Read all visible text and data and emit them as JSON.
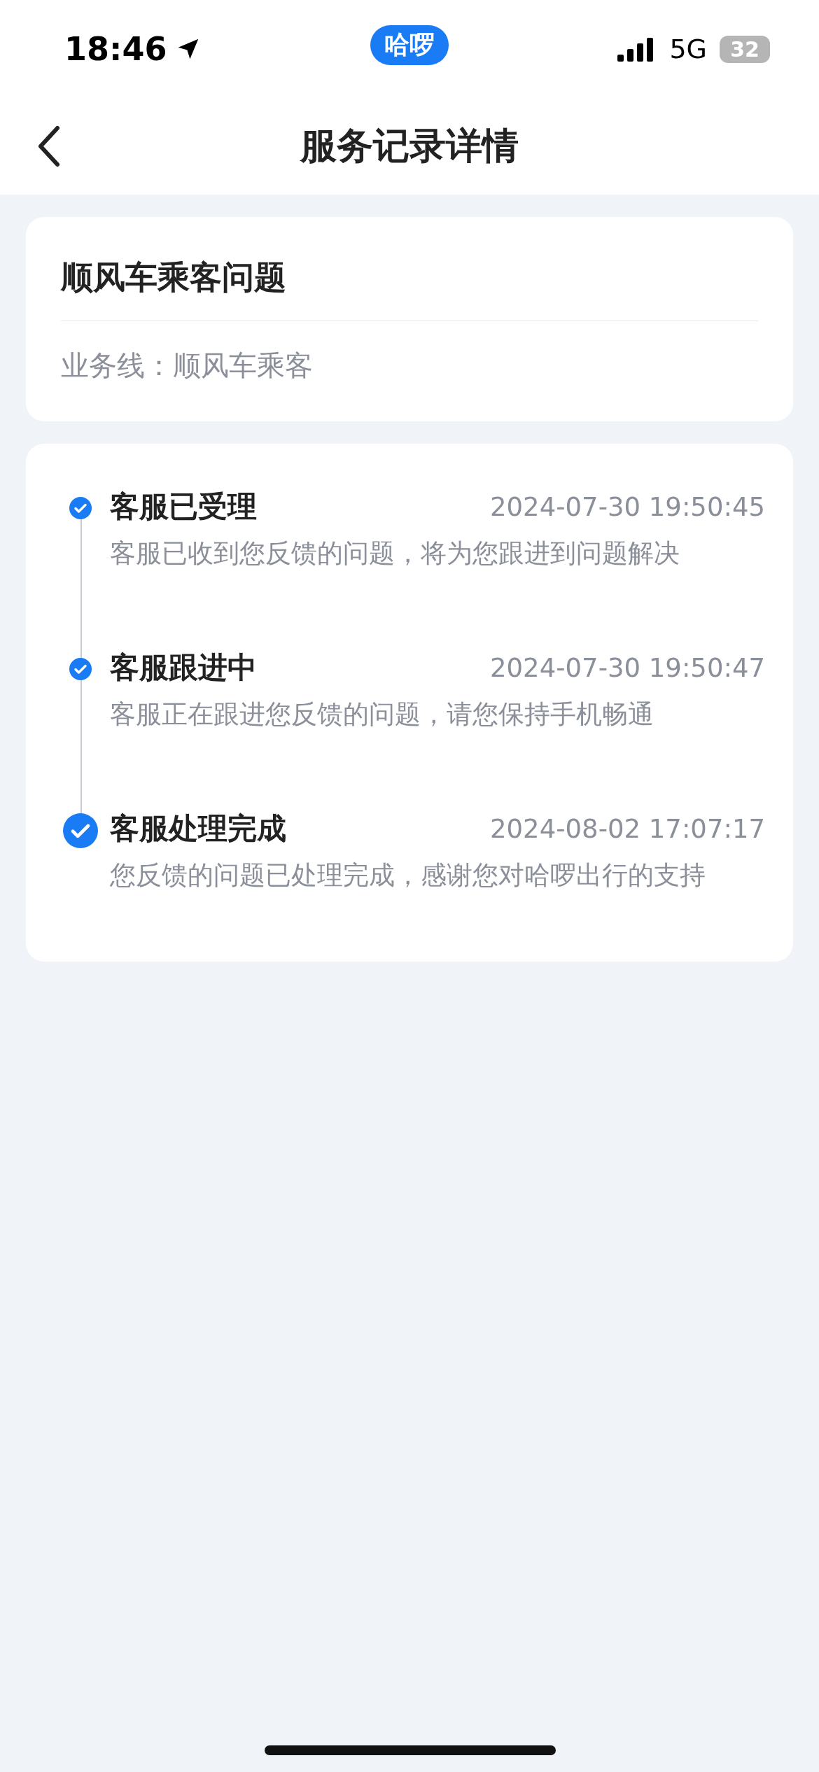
{
  "status_bar": {
    "time": "18:46",
    "app_badge": "哈啰",
    "network": "5G",
    "battery": "32"
  },
  "nav": {
    "title": "服务记录详情"
  },
  "summary": {
    "title": "顺风车乘客问题",
    "business_line": "业务线：顺风车乘客"
  },
  "timeline": [
    {
      "title": "客服已受理",
      "time": "2024-07-30 19:50:45",
      "description": "客服已收到您反馈的问题，将为您跟进到问题解决",
      "current": false
    },
    {
      "title": "客服跟进中",
      "time": "2024-07-30 19:50:47",
      "description": "客服正在跟进您反馈的问题，请您保持手机畅通",
      "current": false
    },
    {
      "title": "客服处理完成",
      "time": "2024-08-02 17:07:17",
      "description": "您反馈的问题已处理完成，感谢您对哈啰出行的支持",
      "current": true
    }
  ]
}
